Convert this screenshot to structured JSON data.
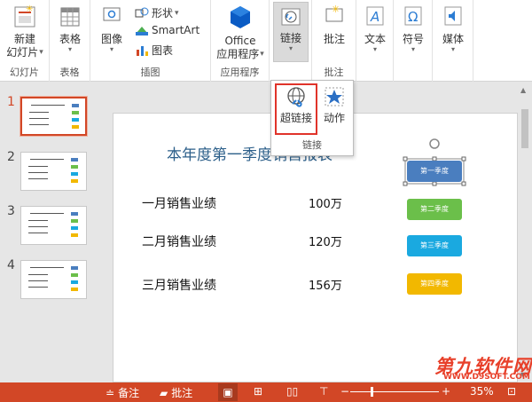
{
  "ribbon": {
    "groups": {
      "slides": {
        "label": "幻灯片",
        "new_slide": "新建",
        "new_slide2": "幻灯片"
      },
      "tables": {
        "label": "表格",
        "table": "表格"
      },
      "illustrations": {
        "label": "插图",
        "images": "图像",
        "shapes": "形状",
        "smartart": "SmartArt",
        "chart": "图表"
      },
      "apps": {
        "label": "应用程序",
        "office": "Office",
        "office2": "应用程序"
      },
      "links": {
        "link": "链接"
      },
      "comments": {
        "label": "批注",
        "comment": "批注"
      },
      "text": {
        "text": "文本"
      },
      "symbols": {
        "symbol": "符号"
      },
      "media": {
        "media": "媒体"
      }
    },
    "arrow": "▾"
  },
  "popup": {
    "hyperlink": "超链接",
    "action": "动作",
    "group_label": "链接"
  },
  "thumbnails": [
    "1",
    "2",
    "3",
    "4"
  ],
  "slide": {
    "title": "本年度第一季度销售报表",
    "rows": [
      {
        "label": "一月销售业绩",
        "value": "100万"
      },
      {
        "label": "二月销售业绩",
        "value": "120万"
      },
      {
        "label": "三月销售业绩",
        "value": "156万"
      }
    ],
    "buttons": [
      {
        "label": "第一季度",
        "color": "#4a7ebf"
      },
      {
        "label": "第二季度",
        "color": "#6bbf4a"
      },
      {
        "label": "第三季度",
        "color": "#1aa9e0"
      },
      {
        "label": "第四季度",
        "color": "#f2b800"
      }
    ]
  },
  "status": {
    "notes": "备注",
    "comments": "批注",
    "zoom": "35%"
  },
  "watermark": {
    "line1": "第九软件网",
    "line2": "WWW.D9SOFT.COM"
  },
  "colors": {
    "accent": "#d24726",
    "title": "#2c5f8a"
  }
}
